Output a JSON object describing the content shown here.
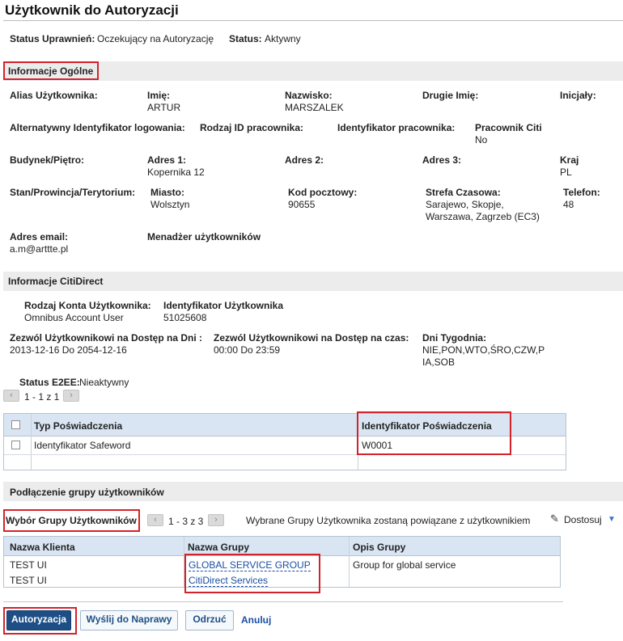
{
  "page": {
    "title": "Użytkownik do Autoryzacji"
  },
  "status": {
    "perm_label": "Status Uprawnień:",
    "perm_value": "Oczekujący na Autoryzację",
    "status_label": "Status:",
    "status_value": "Aktywny"
  },
  "general": {
    "title": "Informacje Ogólne",
    "alias_label": "Alias Użytkownika:",
    "first_name_label": "Imię:",
    "first_name_value": "ARTUR",
    "last_name_label": "Nazwisko:",
    "last_name_value": "MARSZALEK",
    "middle_name_label": "Drugie Imię:",
    "initials_label": "Inicjały:",
    "alt_login_label": "Alternatywny Identyfikator logowania:",
    "emp_id_type_label": "Rodzaj ID pracownika:",
    "emp_id_label": "Identyfikator pracownika:",
    "citi_emp_label": "Pracownik Citi",
    "citi_emp_value": "No",
    "building_label": "Budynek/Piętro:",
    "addr1_label": "Adres 1:",
    "addr1_value": "Kopernika 12",
    "addr2_label": "Adres 2:",
    "addr3_label": "Adres 3:",
    "country_label": "Kraj",
    "country_value": "PL",
    "state_label": "Stan/Prowincja/Terytorium:",
    "city_label": "Miasto:",
    "city_value": "Wolsztyn",
    "zip_label": "Kod pocztowy:",
    "zip_value": "90655",
    "tz_label": "Strefa Czasowa:",
    "tz_value_1": "Sarajewo, Skopje,",
    "tz_value_2": "Warszawa, Zagrzeb (EC3)",
    "phone_label": "Telefon:",
    "phone_value": "48",
    "email_label": "Adres email:",
    "email_value": "a.m@arttte.pl",
    "manager_label": "Menadżer użytkowników"
  },
  "citidirect": {
    "title": "Informacje CitiDirect",
    "acct_type_label": "Rodzaj Konta Użytkownika:",
    "acct_type_value": "Omnibus Account User",
    "user_id_label": "Identyfikator Użytkownika",
    "user_id_value": "51025608",
    "access_days_label": "Zezwól Użytkownikowi na Dostęp na Dni :",
    "access_days_value": "2013-12-16 Do 2054-12-16",
    "access_time_label": "Zezwól Użytkownikowi na Dostęp na czas:",
    "access_time_value": "00:00 Do 23:59",
    "weekdays_label": "Dni Tygodnia:",
    "weekdays_value_1": "NIE,PON,WTO,ŚRO,CZW,P",
    "weekdays_value_2": "IA,SOB",
    "e2ee_label": "Status E2EE:",
    "e2ee_value": "Nieaktywny",
    "pager_text": "1 - 1 z 1",
    "prev_icon": "‹",
    "next_icon": "›"
  },
  "credentials": {
    "headers": [
      "Typ Poświadczenia",
      "Identyfikator Poświadczenia"
    ],
    "rows": [
      {
        "type": "Identyfikator Safeword",
        "id": "W0001"
      }
    ]
  },
  "groups": {
    "title": "Podłączenie grupy użytkowników",
    "selection_label": "Wybór Grupy Użytkowników",
    "pager_text": "1 - 3 z 3",
    "info_text": "Wybrane Grupy Użytkownika zostaną powiązane z użytkownikiem",
    "customize_label": "Dostosuj",
    "customize_icon": "✎",
    "dropdown_icon": "▼",
    "headers": [
      "Nazwa Klienta",
      "Nazwa Grupy",
      "Opis Grupy"
    ],
    "rows": [
      {
        "client": "TEST UI",
        "group": "GLOBAL SERVICE GROUP",
        "desc": "Group for global service"
      },
      {
        "client": "TEST UI",
        "group": "CitiDirect Services",
        "desc": ""
      }
    ]
  },
  "actions": {
    "authorize": "Autoryzacja",
    "send_repair": "Wyślij do Naprawy",
    "reject": "Odrzuć",
    "cancel": "Anuluj"
  }
}
